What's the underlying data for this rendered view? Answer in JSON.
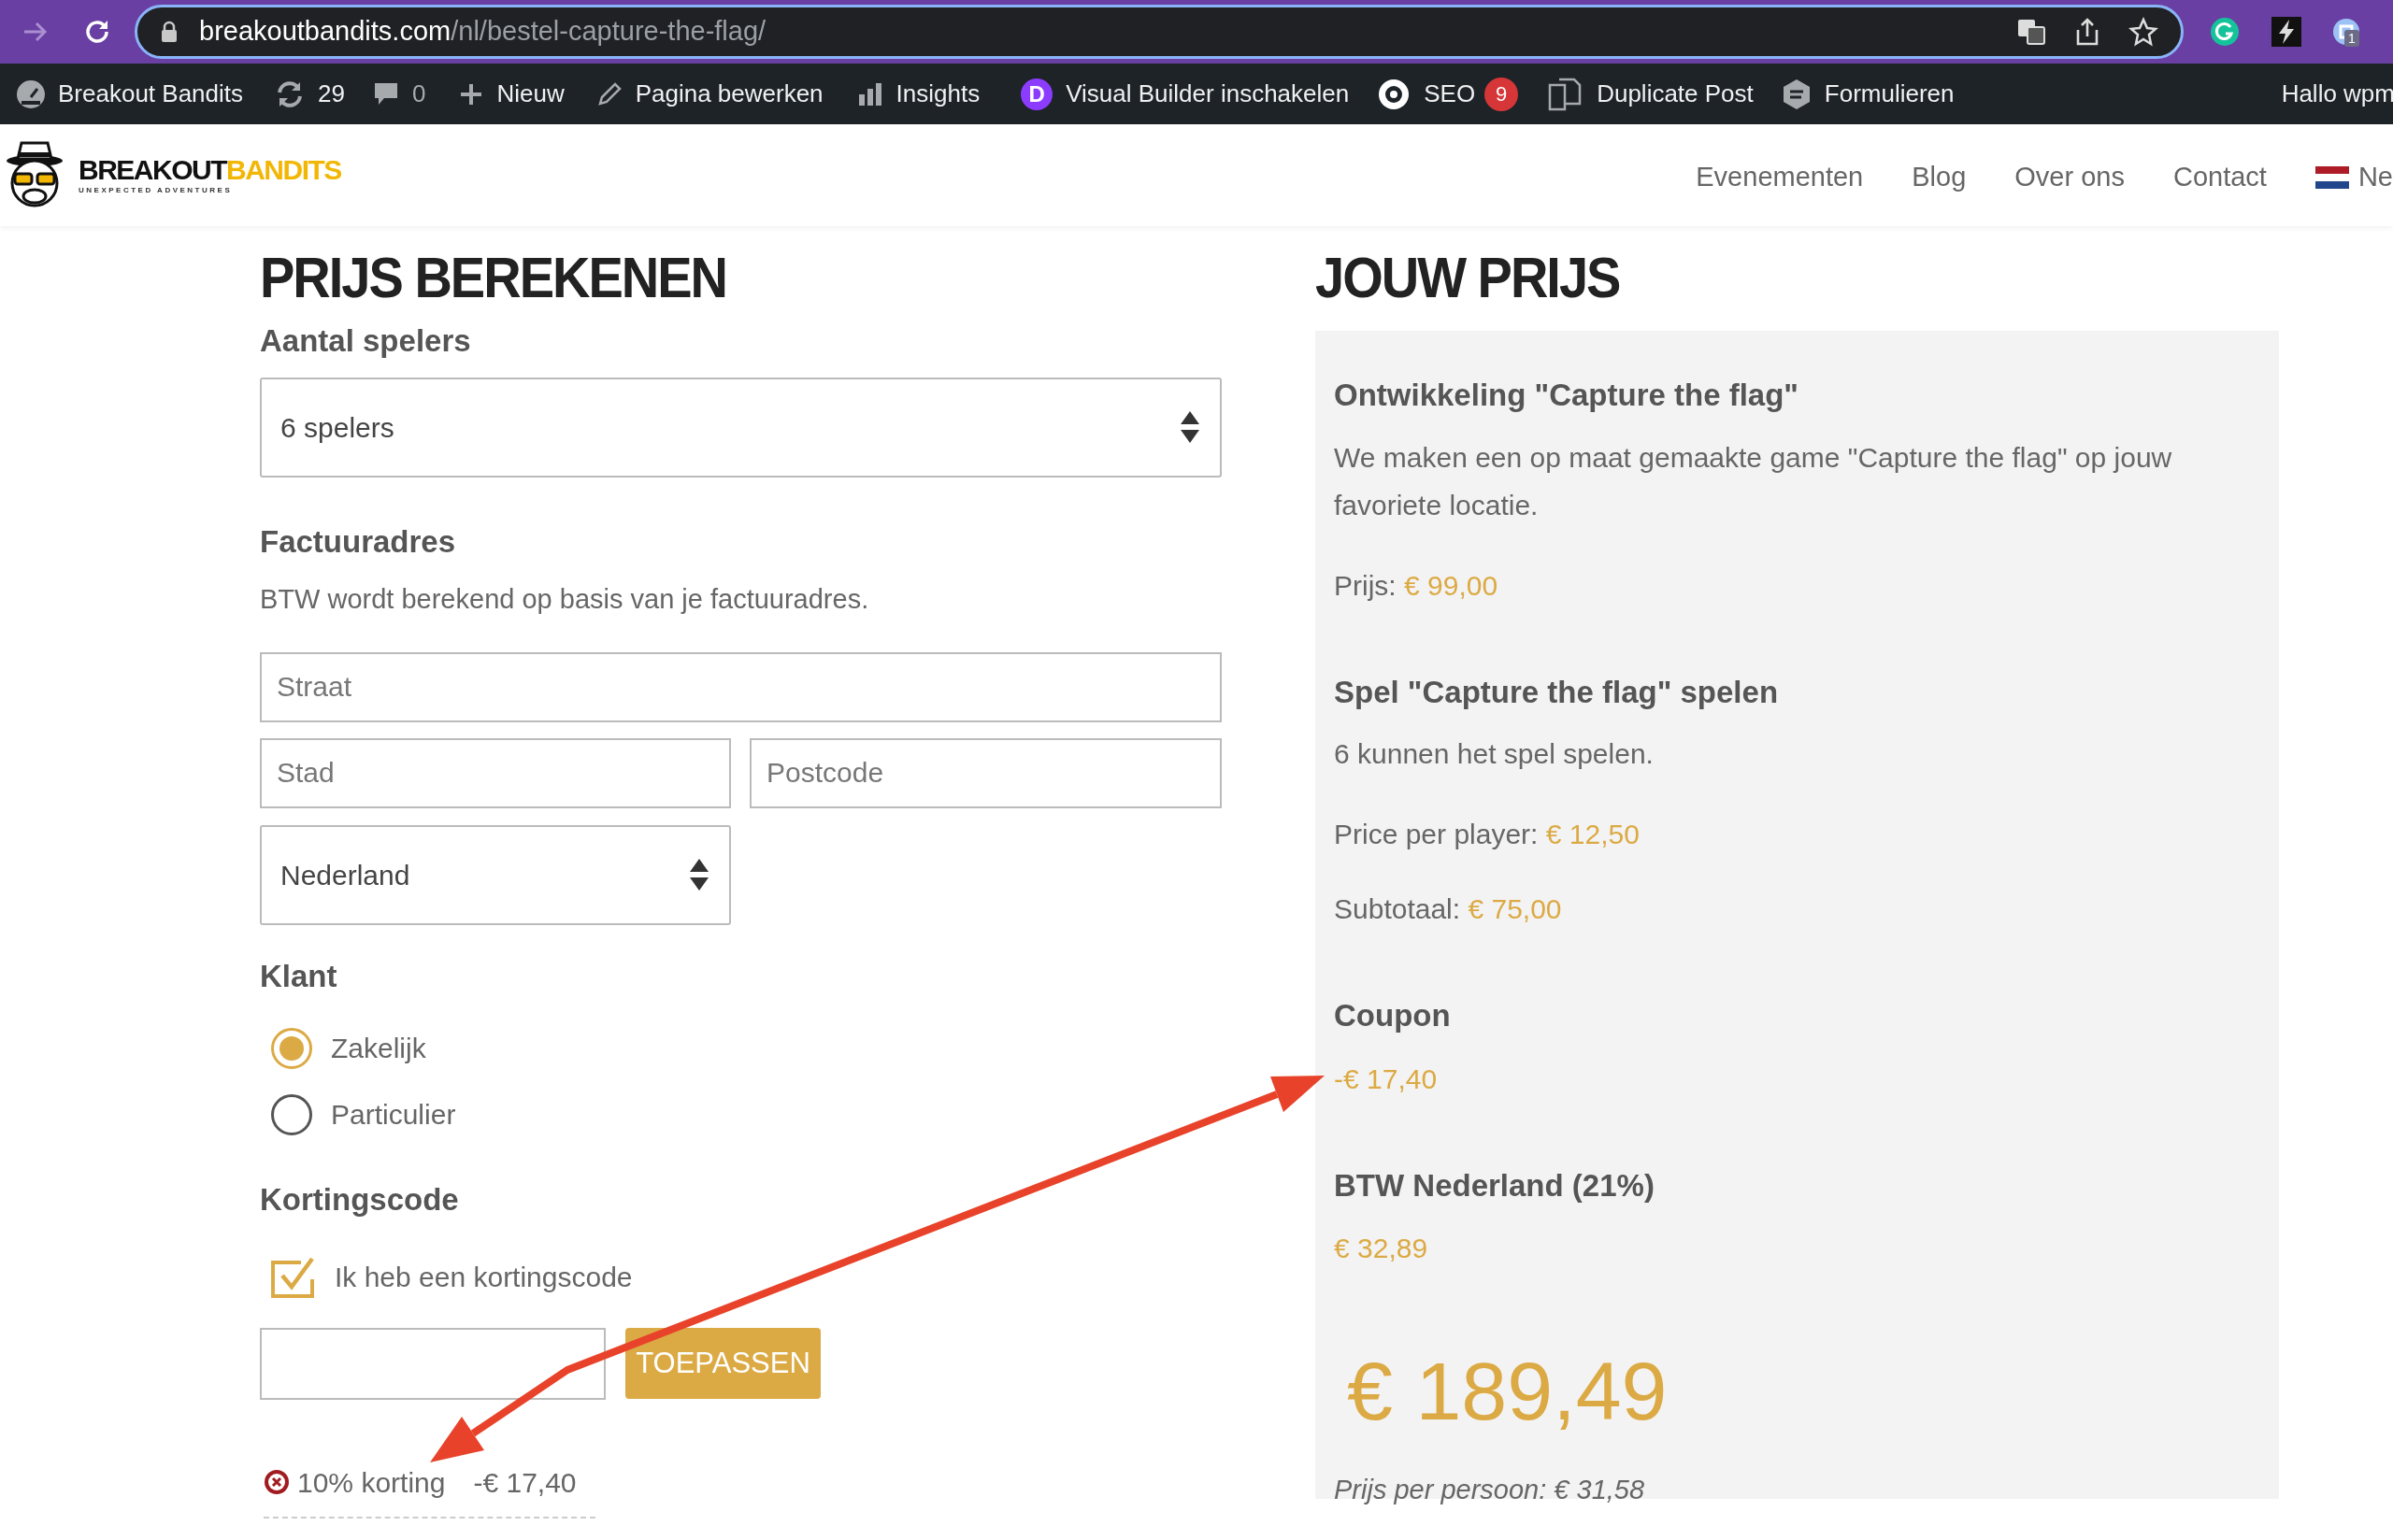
{
  "browser": {
    "url_host": "breakoutbandits.com",
    "url_path": "/nl/bestel-capture-the-flag/",
    "extension_badge": "1"
  },
  "admin_bar": {
    "items": [
      {
        "kind": "site",
        "label": "Breakout Bandits"
      },
      {
        "kind": "updates",
        "label": "29"
      },
      {
        "kind": "comments",
        "label": "0"
      },
      {
        "kind": "new",
        "label": "Nieuw"
      },
      {
        "kind": "edit",
        "label": "Pagina bewerken"
      },
      {
        "kind": "insights",
        "label": "Insights"
      },
      {
        "kind": "divi",
        "label": "Visual Builder inschakelen",
        "icon_letter": "D"
      },
      {
        "kind": "seo",
        "label": "SEO",
        "badge": "9"
      },
      {
        "kind": "duplicate",
        "label": "Duplicate Post"
      },
      {
        "kind": "forms",
        "label": "Formulieren"
      }
    ],
    "greeting": "Hallo wpm"
  },
  "header": {
    "logo": {
      "word1": "BREAKOUT",
      "word2": "BANDITS",
      "tagline": "UNEXPECTED ADVENTURES"
    },
    "nav": [
      "Evenementen",
      "Blog",
      "Over ons",
      "Contact"
    ],
    "language": "Ne"
  },
  "calculator": {
    "title": "PRIJS BEREKENEN",
    "players_label": "Aantal spelers",
    "players_value": "6 spelers",
    "billing_label": "Factuuradres",
    "billing_note": "BTW wordt berekend op basis van je factuuradres.",
    "street_placeholder": "Straat",
    "city_placeholder": "Stad",
    "postcode_placeholder": "Postcode",
    "country_value": "Nederland",
    "customer_label": "Klant",
    "customer_options": [
      {
        "label": "Zakelijk",
        "selected": true
      },
      {
        "label": "Particulier",
        "selected": false
      }
    ],
    "discount_label": "Kortingscode",
    "has_code": {
      "label": "Ik heb een kortingscode",
      "checked": true
    },
    "apply_button": "TOEPASSEN",
    "applied": {
      "name": "10% korting",
      "amount": "-€ 17,40"
    }
  },
  "summary": {
    "title": "JOUW PRIJS",
    "sections": [
      {
        "heading": "Ontwikkeling \"Capture the flag\"",
        "lines": [
          {
            "text": "We maken een op maat gemaakte game \"Capture the flag\" op jouw favoriete locatie."
          },
          {
            "label": "Prijs:",
            "value": "€ 99,00"
          }
        ]
      },
      {
        "heading": "Spel \"Capture the flag\" spelen",
        "lines": [
          {
            "text": "6 kunnen het spel spelen."
          },
          {
            "label": "Price per player:",
            "value": "€ 12,50"
          },
          {
            "label": "Subtotaal:",
            "value": "€ 75,00"
          }
        ]
      },
      {
        "heading": "Coupon",
        "lines": [
          {
            "value": "-€ 17,40"
          }
        ]
      },
      {
        "heading": "BTW Nederland (21%)",
        "lines": [
          {
            "value": "€ 32,89"
          }
        ]
      }
    ],
    "total": "€ 189,49",
    "per_person": "Prijs per persoon: € 31,58"
  }
}
